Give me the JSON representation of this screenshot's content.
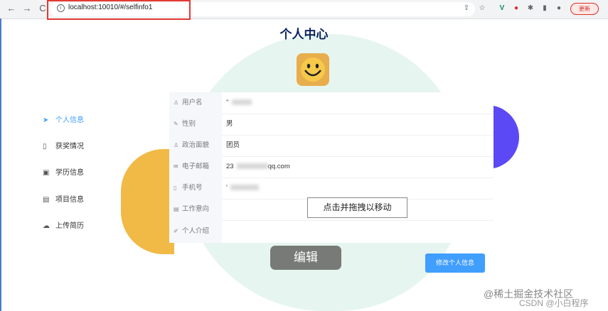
{
  "browser": {
    "url": "localhost:10010/#/selfinfo1",
    "update_label": "更新",
    "back_icon": "←",
    "forward_icon": "→",
    "reload_icon": "C",
    "info_icon": "i"
  },
  "page": {
    "title": "个人中心"
  },
  "sidebar": {
    "items": [
      {
        "icon": "➤",
        "label": "个人信息"
      },
      {
        "icon": "▯",
        "label": "获奖情况"
      },
      {
        "icon": "▣",
        "label": "学历信息"
      },
      {
        "icon": "▤",
        "label": "项目信息"
      },
      {
        "icon": "☁",
        "label": "上传简历"
      }
    ]
  },
  "info": {
    "rows": [
      {
        "icon": "♙",
        "label": "用户名",
        "value": "''"
      },
      {
        "icon": "✎",
        "label": "性别",
        "value": "男"
      },
      {
        "icon": "♙",
        "label": "政治面貌",
        "value": "团员"
      },
      {
        "icon": "✉",
        "label": "电子邮箱",
        "value": "23",
        "value_suffix": "qq.com"
      },
      {
        "icon": "▯",
        "label": "手机号",
        "value": "'"
      },
      {
        "icon": "▤",
        "label": "工作意向",
        "value": ""
      },
      {
        "icon": "✐",
        "label": "个人介绍",
        "value": ""
      }
    ]
  },
  "tooltip": "点击并拖拽以移动",
  "buttons": {
    "edit": "编辑",
    "modify": "修改个人信息"
  },
  "watermark": {
    "site": "@稀土掘金技术社区",
    "csdn": "CSDN @小白程序"
  },
  "colors": {
    "accent": "#409eff",
    "highlight_border": "#e53935",
    "title": "#0f2460"
  }
}
